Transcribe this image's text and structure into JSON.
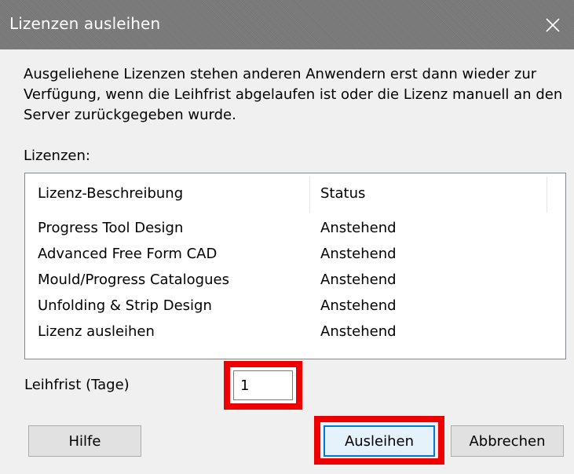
{
  "window": {
    "title": "Lizenzen ausleihen"
  },
  "message": "Ausgeliehene Lizenzen stehen anderen Anwendern erst dann wieder zur Verfügung, wenn die Leihfrist abgelaufen ist oder die Lizenz manuell an den Server zurückgegeben wurde.",
  "list": {
    "label": "Lizenzen:",
    "columns": {
      "description": "Lizenz-Beschreibung",
      "status": "Status"
    },
    "rows": [
      {
        "description": "Progress Tool Design",
        "status": "Anstehend"
      },
      {
        "description": "Advanced Free Form CAD",
        "status": "Anstehend"
      },
      {
        "description": "Mould/Progress Catalogues",
        "status": "Anstehend"
      },
      {
        "description": "Unfolding & Strip Design",
        "status": "Anstehend"
      },
      {
        "description": "Lizenz ausleihen",
        "status": "Anstehend"
      }
    ]
  },
  "leihfrist": {
    "label": "Leihfrist (Tage)",
    "value": "1"
  },
  "buttons": {
    "help": "Hilfe",
    "borrow": "Ausleihen",
    "cancel": "Abbrechen"
  },
  "colors": {
    "titlebar": "#7a7a7a",
    "highlight_box": "#ee0000",
    "focus_border": "#0078d7"
  },
  "icons": {
    "close": "close-icon"
  }
}
